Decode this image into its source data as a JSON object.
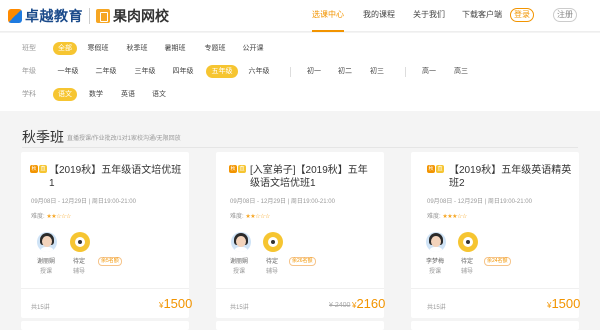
{
  "header": {
    "logo1": "卓越教育",
    "logo2": "果肉网校",
    "nav": [
      "选课中心",
      "我的课程",
      "关于我们",
      "下载客户端"
    ],
    "login": "登录",
    "register": "注册"
  },
  "filters": {
    "class_type": {
      "label": "班型",
      "options": [
        "全部",
        "寒假班",
        "秋季班",
        "暑期班",
        "专题班",
        "公开课"
      ],
      "selected": "全部"
    },
    "grade": {
      "label": "年级",
      "options": [
        "一年级",
        "二年级",
        "三年级",
        "四年级",
        "五年级",
        "六年级",
        "初一",
        "初二",
        "初三",
        "高一",
        "高三"
      ],
      "selected": "五年级"
    },
    "subject": {
      "label": "学科",
      "options": [
        "语文",
        "数学",
        "英语",
        "语文"
      ],
      "selected": "语文"
    }
  },
  "section": {
    "title": "秋季班",
    "subtitle": "直播授课/作业批改/1对1家校沟通/无限回放"
  },
  "cards": [
    {
      "tags": [
        "秋",
        "直"
      ],
      "title": "【2019秋】五年级语文培优班1",
      "time": "09月08日 - 12月29日 | 周日19:00-21:00",
      "difficulty_label": "难度:",
      "stars": "★★☆☆☆",
      "teacher_name": "谢丽娴",
      "teacher_role": "授课",
      "tutor_name": "待定",
      "tutor_role": "辅导",
      "remain": "余5名额",
      "count": "共15讲",
      "price": "1500",
      "currency": "¥",
      "old_price": ""
    },
    {
      "tags": [
        "秋",
        "直"
      ],
      "title": "[入室弟子]【2019秋】五年级语文培优班1",
      "time": "09月08日 - 12月29日 | 周日19:00-21:00",
      "difficulty_label": "难度:",
      "stars": "★★☆☆☆",
      "teacher_name": "谢丽娴",
      "teacher_role": "授课",
      "tutor_name": "待定",
      "tutor_role": "辅导",
      "remain": "余26名额",
      "count": "共15讲",
      "price": "2160",
      "currency": "¥",
      "old_price": "¥ 2400"
    },
    {
      "tags": [
        "秋",
        "直"
      ],
      "title": "【2019秋】五年级英语精英班2",
      "time": "09月08日 - 12月29日 | 周日19:00-21:00",
      "difficulty_label": "难度:",
      "stars": "★★★☆☆",
      "teacher_name": "李梦梅",
      "teacher_role": "授课",
      "tutor_name": "待定",
      "tutor_role": "辅导",
      "remain": "余24名额",
      "count": "共15讲",
      "price": "1500",
      "currency": "¥",
      "old_price": ""
    }
  ],
  "colors": {
    "accent": "#f29400",
    "chip": "#f6c531"
  }
}
